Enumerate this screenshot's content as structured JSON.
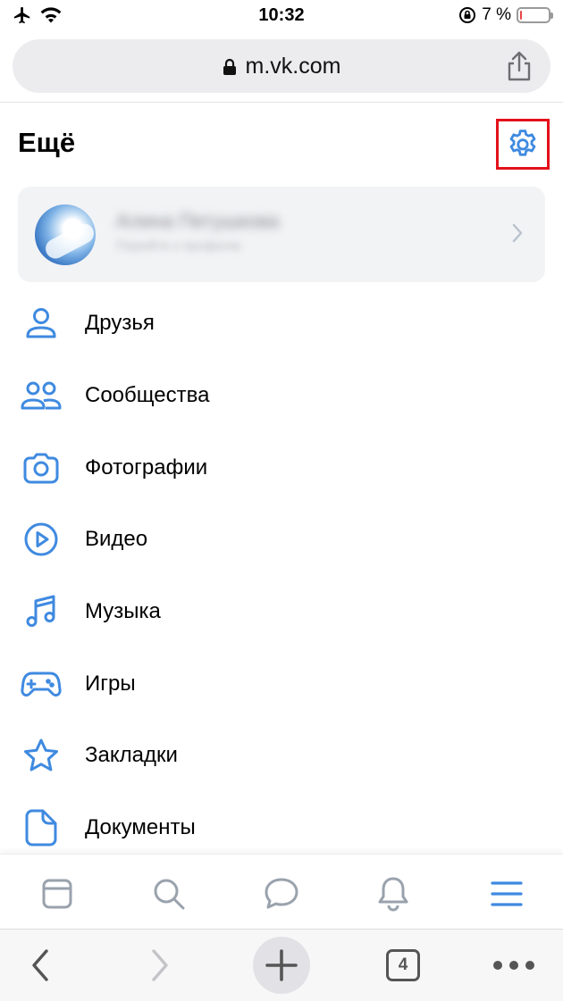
{
  "status_bar": {
    "time": "10:32",
    "battery_text": "7 %",
    "battery_level": 0.07
  },
  "browser": {
    "url": "m.vk.com",
    "tabs_count": "4"
  },
  "page": {
    "title": "Ещё"
  },
  "profile": {
    "name": "Алина Петушкова",
    "subtitle": "Перейти к профилю"
  },
  "menu": {
    "items": [
      {
        "label": "Друзья",
        "icon": "user-icon"
      },
      {
        "label": "Сообщества",
        "icon": "users-icon"
      },
      {
        "label": "Фотографии",
        "icon": "camera-icon"
      },
      {
        "label": "Видео",
        "icon": "play-circle-icon"
      },
      {
        "label": "Музыка",
        "icon": "music-note-icon"
      },
      {
        "label": "Игры",
        "icon": "gamepad-icon"
      },
      {
        "label": "Закладки",
        "icon": "star-icon"
      },
      {
        "label": "Документы",
        "icon": "document-icon"
      }
    ]
  },
  "colors": {
    "accent": "#3f8ae0",
    "highlight_frame": "#e3101b",
    "inactive_icon": "#99a2ad"
  }
}
